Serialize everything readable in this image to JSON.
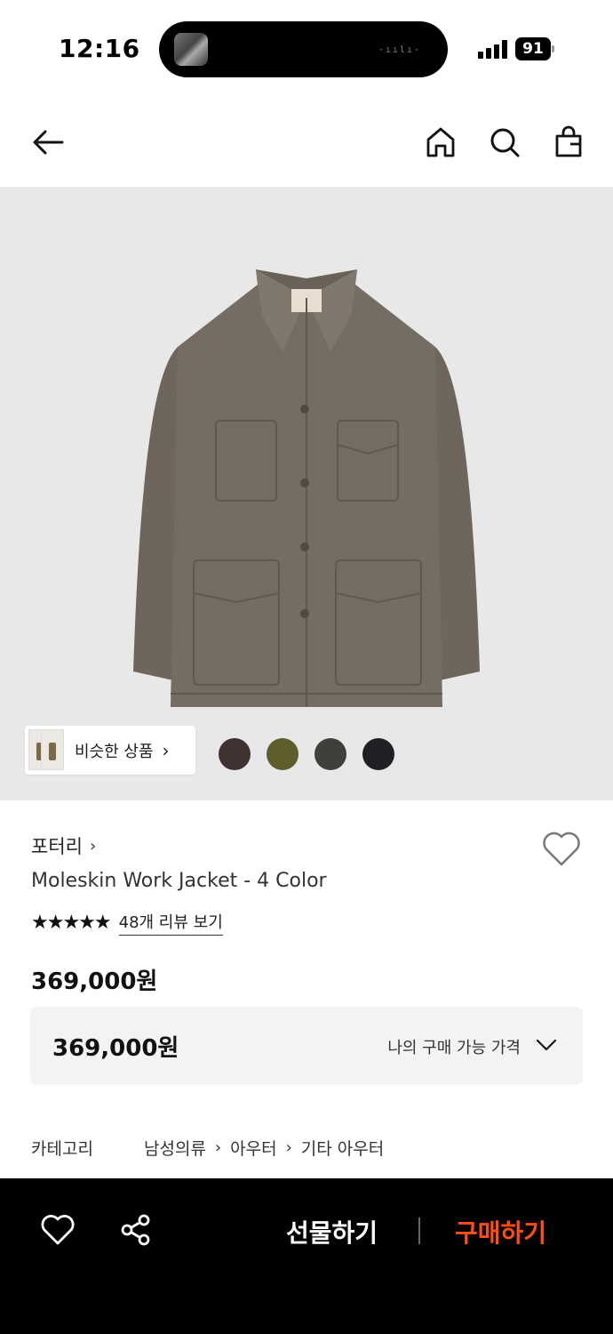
{
  "status_bar": {
    "time": "12:16",
    "battery": "91",
    "icons": [
      "signal-icon",
      "battery-icon"
    ]
  },
  "nav": {
    "icons": [
      "back-arrow-icon",
      "home-icon",
      "search-icon",
      "shopping-bag-icon"
    ]
  },
  "product_image": {
    "similar_label": "비슷한 상품",
    "swatch_colors": [
      "#3e3330",
      "#5e5d2c",
      "#413f3c",
      "#1f2023"
    ]
  },
  "product": {
    "brand": "포터리",
    "title": "Moleskin Work Jacket - 4 Color",
    "stars": "★★★★★",
    "rating": 5,
    "review_link": "48개 리뷰 보기",
    "price": "369,000원",
    "price_box": {
      "value": "369,000원",
      "label": "나의 구매 가능 가격"
    },
    "category": {
      "label": "카테고리",
      "path": [
        "남성의류",
        "아우터",
        "기타 아우터"
      ]
    }
  },
  "bottom_bar": {
    "gift_label": "선물하기",
    "buy_label": "구매하기",
    "buy_color": "#ff4d14",
    "icons": [
      "heart-icon",
      "share-icon"
    ]
  }
}
